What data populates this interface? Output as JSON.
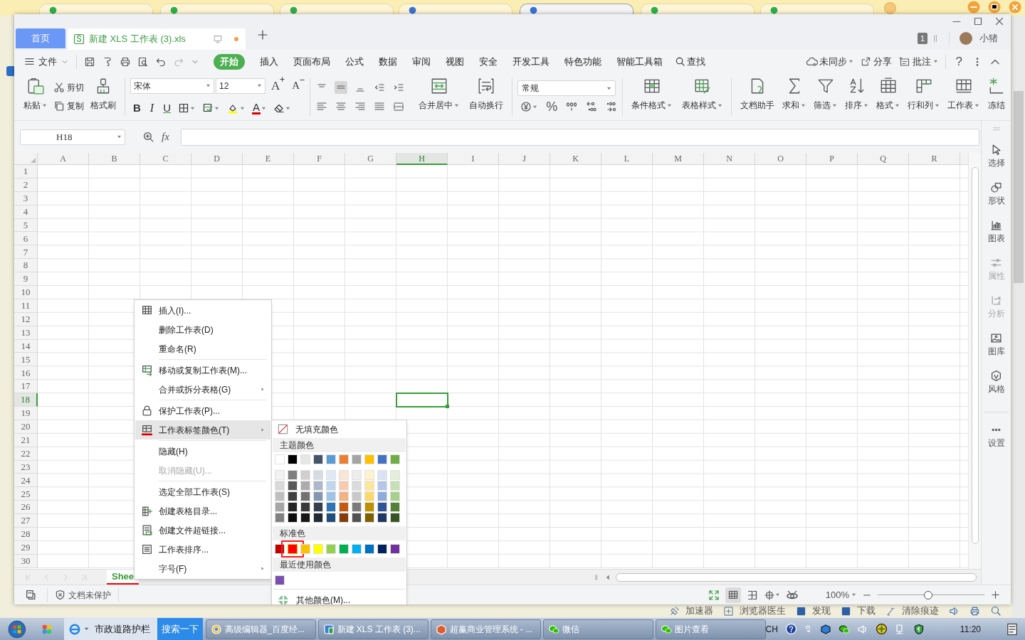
{
  "browser_tabs": [
    {
      "selected": false
    },
    {
      "selected": false
    },
    {
      "selected": false
    },
    {
      "selected": false
    },
    {
      "selected": true
    },
    {
      "selected": false
    },
    {
      "selected": false
    }
  ],
  "window": {
    "home_tab": "首页",
    "document_tab": {
      "title": "新建 XLS 工作表 (3).xls",
      "modified": true
    },
    "page_badge": "1",
    "user": "小猪"
  },
  "menu_bar": {
    "file": "文件",
    "tabs": [
      {
        "label": "开始",
        "selected": true
      },
      {
        "label": "插入",
        "selected": false
      },
      {
        "label": "页面布局",
        "selected": false
      },
      {
        "label": "公式",
        "selected": false
      },
      {
        "label": "数据",
        "selected": false
      },
      {
        "label": "审阅",
        "selected": false
      },
      {
        "label": "视图",
        "selected": false
      },
      {
        "label": "安全",
        "selected": false
      },
      {
        "label": "开发工具",
        "selected": false
      },
      {
        "label": "特色功能",
        "selected": false
      },
      {
        "label": "智能工具箱",
        "selected": false
      }
    ],
    "search": "查找",
    "sync": "未同步",
    "share": "分享",
    "comment": "批注",
    "help": "?"
  },
  "ribbon": {
    "paste": "粘贴",
    "cut": "剪切",
    "copy": "复制",
    "format_painter": "格式刷",
    "font": "宋体",
    "font_size": "12",
    "grow_font": "A",
    "shrink_font": "A",
    "bold": "B",
    "italic": "I",
    "underline": "U",
    "font_color": "A",
    "percent": "%",
    "number_format": "常规",
    "tools": [
      {
        "label": "合并居中",
        "dropdown": true
      },
      {
        "label": "自动换行",
        "dropdown": false
      }
    ],
    "style_tools": [
      {
        "label": "条件格式",
        "dropdown": true
      },
      {
        "label": "表格样式",
        "dropdown": true
      }
    ],
    "edit_tools": [
      {
        "label": "文档助手",
        "dropdown": false
      },
      {
        "label": "求和",
        "dropdown": true
      },
      {
        "label": "筛选",
        "dropdown": true
      },
      {
        "label": "排序",
        "dropdown": true
      },
      {
        "label": "格式",
        "dropdown": true
      },
      {
        "label": "行和列",
        "dropdown": true
      },
      {
        "label": "工作表",
        "dropdown": true
      },
      {
        "label": "冻结",
        "dropdown": false
      }
    ]
  },
  "formula_bar": {
    "name_box": "H18",
    "fx": "fx"
  },
  "grid": {
    "columns": [
      {
        "label": "A",
        "selected": false
      },
      {
        "label": "B",
        "selected": false
      },
      {
        "label": "C",
        "selected": false
      },
      {
        "label": "D",
        "selected": false
      },
      {
        "label": "E",
        "selected": false
      },
      {
        "label": "F",
        "selected": false
      },
      {
        "label": "G",
        "selected": false
      },
      {
        "label": "H",
        "selected": true
      },
      {
        "label": "I",
        "selected": false
      },
      {
        "label": "J",
        "selected": false
      },
      {
        "label": "K",
        "selected": false
      },
      {
        "label": "L",
        "selected": false
      },
      {
        "label": "M",
        "selected": false
      },
      {
        "label": "N",
        "selected": false
      },
      {
        "label": "O",
        "selected": false
      },
      {
        "label": "P",
        "selected": false
      },
      {
        "label": "Q",
        "selected": false
      },
      {
        "label": "R",
        "selected": false
      }
    ],
    "rows": [
      {
        "label": "1",
        "selected": false
      },
      {
        "label": "2",
        "selected": false
      },
      {
        "label": "3",
        "selected": false
      },
      {
        "label": "4",
        "selected": false
      },
      {
        "label": "5",
        "selected": false
      },
      {
        "label": "6",
        "selected": false
      },
      {
        "label": "7",
        "selected": false
      },
      {
        "label": "8",
        "selected": false
      },
      {
        "label": "9",
        "selected": false
      },
      {
        "label": "10",
        "selected": false
      },
      {
        "label": "11",
        "selected": false
      },
      {
        "label": "12",
        "selected": false
      },
      {
        "label": "13",
        "selected": false
      },
      {
        "label": "14",
        "selected": false
      },
      {
        "label": "15",
        "selected": false
      },
      {
        "label": "16",
        "selected": false
      },
      {
        "label": "17",
        "selected": false
      },
      {
        "label": "18",
        "selected": true
      },
      {
        "label": "19",
        "selected": false
      },
      {
        "label": "20",
        "selected": false
      },
      {
        "label": "21",
        "selected": false
      },
      {
        "label": "22",
        "selected": false
      },
      {
        "label": "23",
        "selected": false
      },
      {
        "label": "24",
        "selected": false
      },
      {
        "label": "25",
        "selected": false
      },
      {
        "label": "26",
        "selected": false
      },
      {
        "label": "27",
        "selected": false
      },
      {
        "label": "28",
        "selected": false
      },
      {
        "label": "29",
        "selected": false
      },
      {
        "label": "30",
        "selected": false
      }
    ]
  },
  "sheet_tabs": [
    {
      "label": "Shee",
      "selected": true,
      "color": "#ff0000"
    }
  ],
  "side_panel": [
    {
      "label": "选择",
      "disabled": false
    },
    {
      "label": "形状",
      "disabled": false
    },
    {
      "label": "图表",
      "disabled": false
    },
    {
      "label": "属性",
      "disabled": true
    },
    {
      "label": "分析",
      "disabled": true
    },
    {
      "label": "图库",
      "disabled": false
    },
    {
      "label": "风格",
      "disabled": false
    },
    {
      "label": "设置",
      "disabled": false
    }
  ],
  "sheet_context_menu": {
    "groups": [
      {
        "items": [
          {
            "label": "插入(I)...",
            "submenu": false,
            "selected": false,
            "disabled": false
          },
          {
            "label": "删除工作表(D)",
            "submenu": false,
            "selected": false,
            "disabled": false
          },
          {
            "label": "重命名(R)",
            "submenu": false,
            "selected": false,
            "disabled": false
          }
        ]
      },
      {
        "items": [
          {
            "label": "移动或复制工作表(M)...",
            "submenu": false,
            "selected": false,
            "disabled": false
          },
          {
            "label": "合并或拆分表格(G)",
            "submenu": true,
            "selected": false,
            "disabled": false
          }
        ]
      },
      {
        "items": [
          {
            "label": "保护工作表(P)...",
            "submenu": false,
            "selected": false,
            "disabled": false
          },
          {
            "label": "工作表标签颜色(T)",
            "submenu": true,
            "selected": true,
            "disabled": false
          }
        ]
      },
      {
        "items": [
          {
            "label": "隐藏(H)",
            "submenu": false,
            "selected": false,
            "disabled": false
          },
          {
            "label": "取消隐藏(U)...",
            "submenu": false,
            "selected": false,
            "disabled": true
          }
        ]
      },
      {
        "items": [
          {
            "label": "选定全部工作表(S)",
            "submenu": false,
            "selected": false,
            "disabled": false
          },
          {
            "label": "创建表格目录...",
            "submenu": false,
            "selected": false,
            "disabled": false
          },
          {
            "label": "创建文件超链接...",
            "submenu": false,
            "selected": false,
            "disabled": false
          },
          {
            "label": "工作表排序...",
            "submenu": false,
            "selected": false,
            "disabled": false
          },
          {
            "label": "字号(F)",
            "submenu": true,
            "selected": false,
            "disabled": false
          }
        ]
      }
    ]
  },
  "tab_color_menu": {
    "no_fill": "无填充颜色",
    "theme_label": "主题颜色",
    "theme_colors": [
      {
        "color": "#ffffff",
        "selected": false
      },
      {
        "color": "#000000",
        "selected": false
      },
      {
        "color": "#e7e6e6",
        "selected": false
      },
      {
        "color": "#44546a",
        "selected": false
      },
      {
        "color": "#5b9bd5",
        "selected": false
      },
      {
        "color": "#ed7d31",
        "selected": false
      },
      {
        "color": "#a5a5a5",
        "selected": false
      },
      {
        "color": "#ffc000",
        "selected": false
      },
      {
        "color": "#4472c4",
        "selected": false
      },
      {
        "color": "#70ad47",
        "selected": false
      }
    ],
    "shade_rows": [
      {
        "swatches": [
          {
            "color": "#f2f2f2",
            "selected": false
          },
          {
            "color": "#7f7f7f",
            "selected": false
          },
          {
            "color": "#d0cece",
            "selected": false
          },
          {
            "color": "#d6dce4",
            "selected": false
          },
          {
            "color": "#deebf6",
            "selected": false
          },
          {
            "color": "#fbe5d5",
            "selected": false
          },
          {
            "color": "#ededed",
            "selected": false
          },
          {
            "color": "#fff2cc",
            "selected": false
          },
          {
            "color": "#dae3f3",
            "selected": false
          },
          {
            "color": "#e2efd9",
            "selected": false
          }
        ]
      },
      {
        "swatches": [
          {
            "color": "#d9d9d9",
            "selected": false
          },
          {
            "color": "#595959",
            "selected": false
          },
          {
            "color": "#aeabab",
            "selected": false
          },
          {
            "color": "#adb9ca",
            "selected": false
          },
          {
            "color": "#bdd7ee",
            "selected": false
          },
          {
            "color": "#f8cbad",
            "selected": false
          },
          {
            "color": "#dbdbdb",
            "selected": false
          },
          {
            "color": "#ffe699",
            "selected": false
          },
          {
            "color": "#b4c7e7",
            "selected": false
          },
          {
            "color": "#c5e0b3",
            "selected": false
          }
        ]
      },
      {
        "swatches": [
          {
            "color": "#bfbfbf",
            "selected": false
          },
          {
            "color": "#404040",
            "selected": false
          },
          {
            "color": "#757171",
            "selected": false
          },
          {
            "color": "#8497b0",
            "selected": false
          },
          {
            "color": "#9dc3e6",
            "selected": false
          },
          {
            "color": "#f4b183",
            "selected": false
          },
          {
            "color": "#c9c9c9",
            "selected": false
          },
          {
            "color": "#ffd965",
            "selected": false
          },
          {
            "color": "#8faadc",
            "selected": false
          },
          {
            "color": "#a8d08d",
            "selected": false
          }
        ]
      },
      {
        "swatches": [
          {
            "color": "#a6a6a6",
            "selected": false
          },
          {
            "color": "#262626",
            "selected": false
          },
          {
            "color": "#3a3838",
            "selected": false
          },
          {
            "color": "#333f4f",
            "selected": false
          },
          {
            "color": "#2e75b5",
            "selected": false
          },
          {
            "color": "#c55a11",
            "selected": false
          },
          {
            "color": "#7b7b7b",
            "selected": false
          },
          {
            "color": "#bf9000",
            "selected": false
          },
          {
            "color": "#2f5597",
            "selected": false
          },
          {
            "color": "#538135",
            "selected": false
          }
        ]
      },
      {
        "swatches": [
          {
            "color": "#808080",
            "selected": false
          },
          {
            "color": "#0d0d0d",
            "selected": false
          },
          {
            "color": "#171616",
            "selected": false
          },
          {
            "color": "#222a35",
            "selected": false
          },
          {
            "color": "#1f4e79",
            "selected": false
          },
          {
            "color": "#843c0b",
            "selected": false
          },
          {
            "color": "#525252",
            "selected": false
          },
          {
            "color": "#7f6000",
            "selected": false
          },
          {
            "color": "#203864",
            "selected": false
          },
          {
            "color": "#375623",
            "selected": false
          }
        ]
      }
    ],
    "standard_label": "标准色",
    "standard_colors": [
      {
        "color": "#c00000",
        "selected": false
      },
      {
        "color": "#ff0000",
        "selected": true
      },
      {
        "color": "#ffc000",
        "selected": false
      },
      {
        "color": "#ffff00",
        "selected": false
      },
      {
        "color": "#92d050",
        "selected": false
      },
      {
        "color": "#00b050",
        "selected": false
      },
      {
        "color": "#00b0f0",
        "selected": false
      },
      {
        "color": "#0070c0",
        "selected": false
      },
      {
        "color": "#002060",
        "selected": false
      },
      {
        "color": "#7030a0",
        "selected": false
      }
    ],
    "recent_label": "最近使用颜色",
    "recent_colors": [
      {
        "color": "#7b4fb0",
        "selected": false
      }
    ],
    "more_colors": "其他颜色(M)..."
  },
  "status_bar": {
    "protection": "文档未保护",
    "zoom": "100%",
    "zoom_slider": {
      "level": 0.47
    }
  },
  "browser_status": [
    "加速器",
    "浏览器医生",
    "发现",
    "下载",
    "清除痕迹"
  ],
  "taskbar": {
    "address": "市政道路护栏",
    "search_button": "搜索一下",
    "tasks": [
      {
        "label": "高级编辑器_百度经..."
      },
      {
        "label": "新建 XLS 工作表 (3)..."
      },
      {
        "label": "超赢商业管理系统 - ..."
      },
      {
        "label": "微信"
      },
      {
        "label": "图片查看"
      }
    ],
    "ime": "CH",
    "clock": "11:20"
  }
}
